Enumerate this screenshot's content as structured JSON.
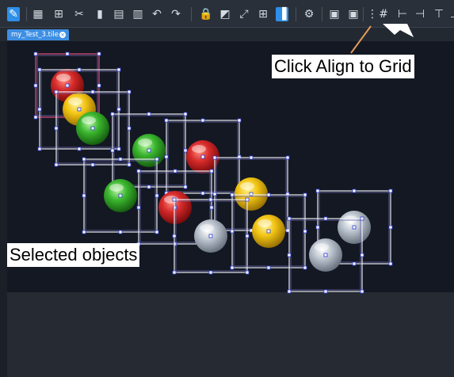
{
  "toolbar": {
    "icons": [
      {
        "name": "edit-mode-icon",
        "glyph": "✎",
        "active": true
      },
      {
        "name": "grid-layout-icon",
        "glyph": "▦"
      },
      {
        "name": "group-icon",
        "glyph": "⊞"
      },
      {
        "name": "cut-icon",
        "glyph": "✂"
      },
      {
        "name": "copy-icon",
        "glyph": "▮"
      },
      {
        "name": "paste-icon",
        "glyph": "▤"
      },
      {
        "name": "delete-icon",
        "glyph": "▥"
      },
      {
        "name": "undo-icon",
        "glyph": "↶"
      },
      {
        "name": "redo-icon",
        "glyph": "↷"
      },
      {
        "name": "lock-icon",
        "glyph": "🔒"
      },
      {
        "name": "bring-front-icon",
        "glyph": "◩"
      },
      {
        "name": "fit-icon",
        "glyph": "⤢"
      },
      {
        "name": "table-icon",
        "glyph": "⊞"
      },
      {
        "name": "distribute-icon",
        "glyph": "▐",
        "active": true
      },
      {
        "name": "settings-icon",
        "glyph": "⚙"
      },
      {
        "name": "camera-icon",
        "glyph": "▣"
      },
      {
        "name": "snapshot-icon",
        "glyph": "▣"
      },
      {
        "name": "align-to-grid-icon",
        "glyph": "⋮"
      },
      {
        "name": "grid-icon",
        "glyph": "#"
      },
      {
        "name": "align-left-icon",
        "glyph": "⊢"
      },
      {
        "name": "align-right-icon",
        "glyph": "⊣"
      },
      {
        "name": "align-top-icon",
        "glyph": "⊤"
      },
      {
        "name": "align-bottom-icon",
        "glyph": "⊥"
      }
    ]
  },
  "tab": {
    "label": "my_Test_3.tile",
    "close": "×"
  },
  "colors": {
    "red": "#d62a2a",
    "yellow": "#f2c413",
    "green": "#3ab62e",
    "gray": "#b9c2cc",
    "selection": "#e8ecf3",
    "primary_selection": "#e24a7a"
  },
  "objects": [
    {
      "color": "red",
      "primary": true
    },
    {
      "color": "yellow"
    },
    {
      "color": "green"
    },
    {
      "color": "green"
    },
    {
      "color": "red"
    },
    {
      "color": "green"
    },
    {
      "color": "red"
    },
    {
      "color": "yellow"
    },
    {
      "color": "gray"
    },
    {
      "color": "yellow"
    },
    {
      "color": "gray"
    },
    {
      "color": "gray"
    }
  ],
  "annotations": {
    "align_to_grid": "Click Align to Grid",
    "selected_objects": "Selected objects"
  }
}
